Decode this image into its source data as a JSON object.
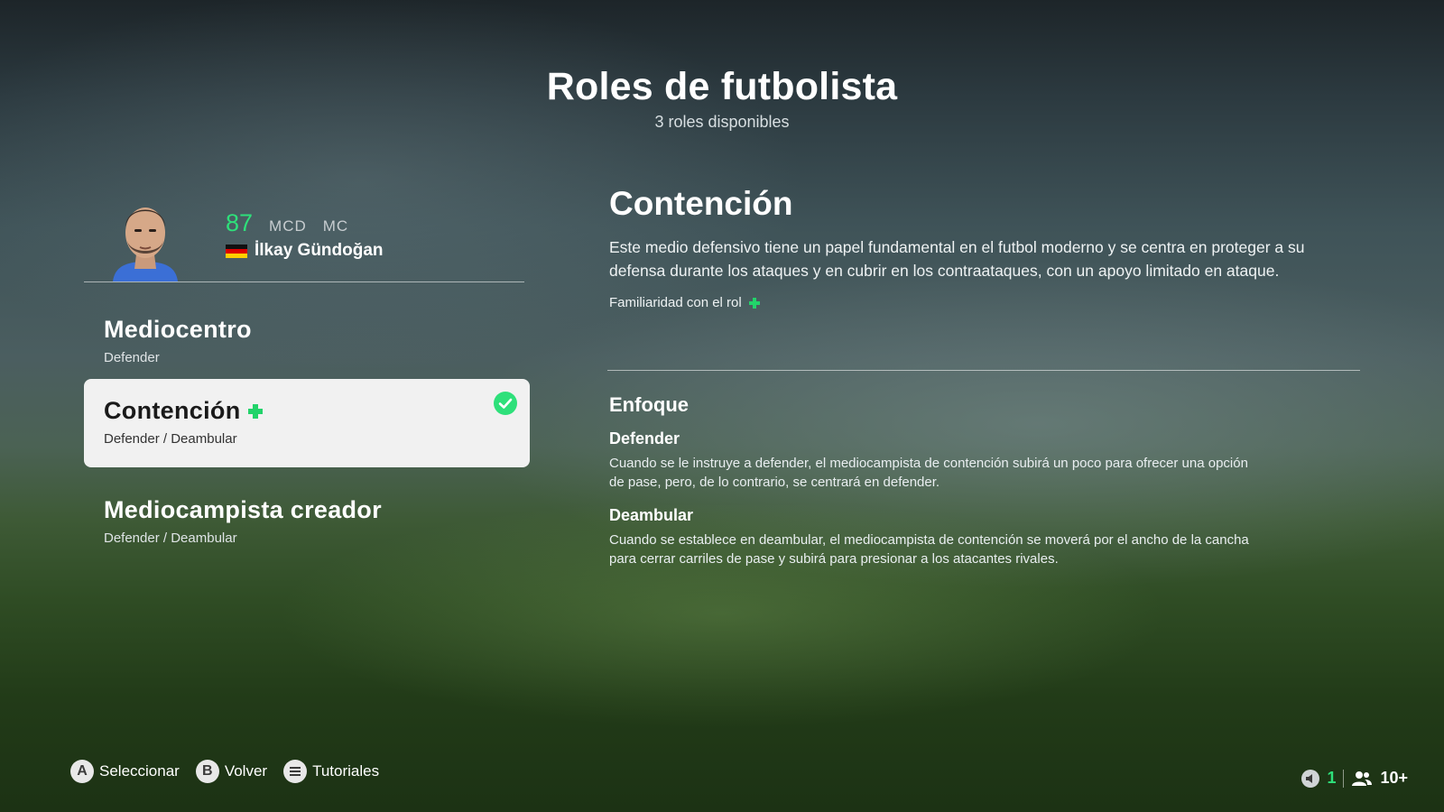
{
  "header": {
    "title": "Roles de futbolista",
    "subtitle": "3 roles disponibles"
  },
  "player": {
    "rating": "87",
    "positions": [
      "MCD",
      "MC"
    ],
    "name": "İlkay Gündoğan",
    "nationality_flag": "germany-flag"
  },
  "roles": [
    {
      "name": "Mediocentro",
      "focus": "Defender",
      "selected": false,
      "familiar": false
    },
    {
      "name": "Contención",
      "focus": "Defender / Deambular",
      "selected": true,
      "familiar": true
    },
    {
      "name": "Mediocampista creador",
      "focus": "Defender / Deambular",
      "selected": false,
      "familiar": false
    }
  ],
  "detail": {
    "title": "Contención",
    "description": "Este medio defensivo tiene un papel fundamental en el futbol moderno y se centra en proteger a su defensa durante los ataques y en cubrir en los contraataques, con un apoyo limitado en ataque.",
    "familiarity_label": "Familiaridad con el rol"
  },
  "focus": {
    "title": "Enfoque",
    "items": [
      {
        "name": "Defender",
        "text": "Cuando se le instruye a defender, el mediocampista de contención subirá un poco para ofrecer una opción de pase, pero, de lo contrario, se centrará en defender."
      },
      {
        "name": "Deambular",
        "text": "Cuando se establece en deambular, el mediocampista de contención se moverá por el ancho de la cancha para cerrar carriles de pase y subirá para presionar a los atacantes rivales."
      }
    ]
  },
  "footer": {
    "hints": [
      {
        "glyph": "A",
        "label": "Seleccionar"
      },
      {
        "glyph": "B",
        "label": "Volver"
      },
      {
        "glyph": "menu-icon",
        "label": "Tutoriales"
      }
    ],
    "status": {
      "voice_count": "1",
      "players": "10+"
    }
  },
  "colors": {
    "accent_green": "#2ee07a",
    "plus_green": "#22d36a",
    "selected_bg": "#f1f1f1"
  }
}
